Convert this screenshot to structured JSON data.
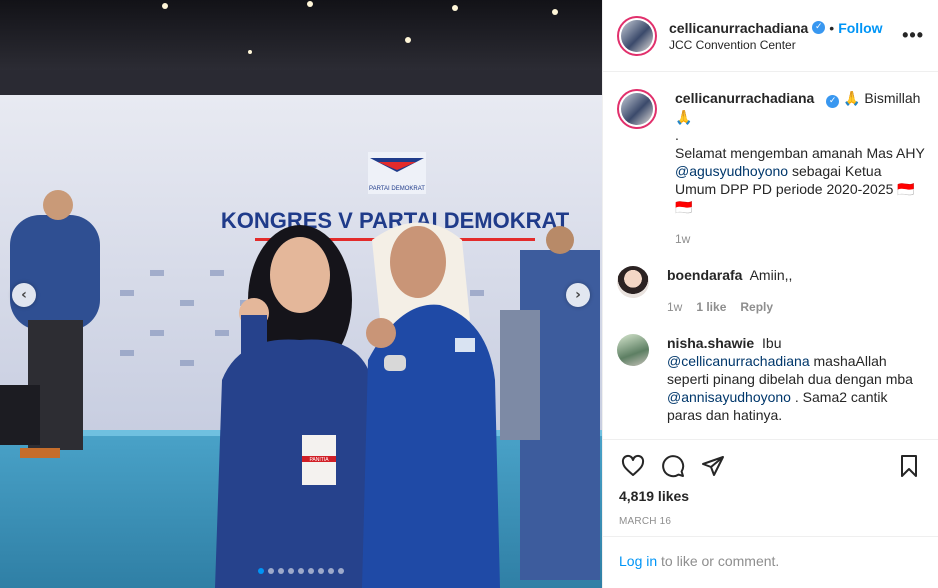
{
  "post": {
    "username": "cellicanurrachadiana",
    "follow_label": "Follow",
    "separator": "•",
    "location": "JCC Convention Center",
    "more_label": "•••"
  },
  "photo": {
    "banner_text": "KONGRES V PARTAI DEMOKRAT",
    "logo_text": "PARTAI DEMOKRAT",
    "badge_text": "PANITIA",
    "prev_label": "‹",
    "next_label": "›",
    "slides_total": 9,
    "slide_active": 1
  },
  "caption": {
    "username": "cellicanurrachadiana",
    "line1": "🙏 Bismillah",
    "line1b": "🙏",
    "dot": ".",
    "text_a": "Selamat mengemban amanah Mas AHY ",
    "mention": "@agusyudhoyono",
    "text_b": " sebagai Ketua Umum DPP PD periode 2020-2025 🇮🇩",
    "flag2": "🇮🇩",
    "time": "1w"
  },
  "comments": [
    {
      "username": "boendarafa",
      "text": "Amiin,,",
      "time": "1w",
      "likes": "1 like",
      "reply": "Reply"
    },
    {
      "username": "nisha.shawie",
      "text_a": "Ibu ",
      "mention1": "@cellicanurrachadiana",
      "text_b": " mashaAllah seperti pinang dibelah dua dengan mba ",
      "mention2": "@annisayudhoyono",
      "text_c": " . Sama2 cantik paras dan hatinya."
    }
  ],
  "stats": {
    "likes": "4,819 likes",
    "date": "MARCH 16"
  },
  "login": {
    "link": "Log in",
    "text": " to like or comment."
  },
  "colors": {
    "accent": "#0095f6",
    "verified": "#3897f0",
    "muted": "#8e8e8e"
  }
}
